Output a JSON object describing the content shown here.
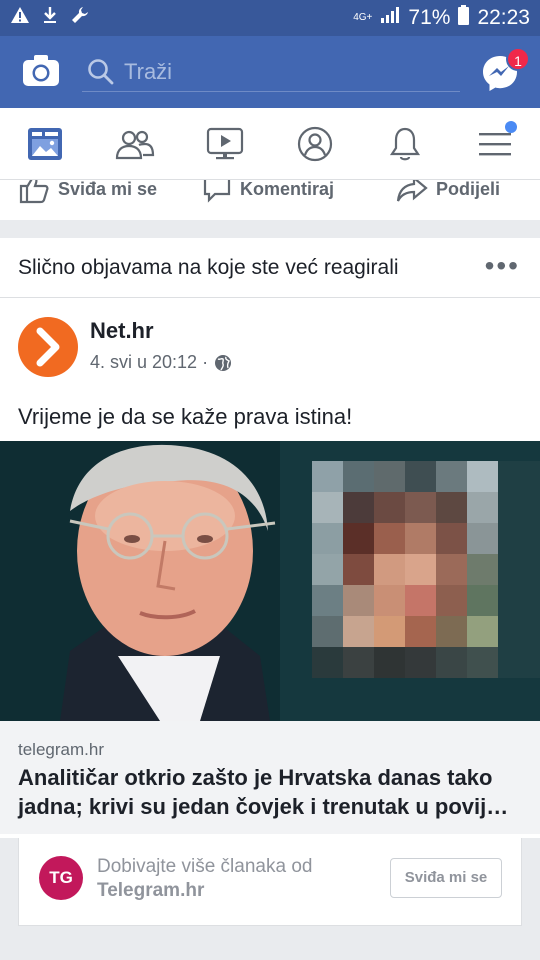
{
  "status_bar": {
    "network": "4G+",
    "battery_percent": "71%",
    "time": "22:23"
  },
  "header": {
    "search_placeholder": "Traži",
    "messenger_badge": "1"
  },
  "nav": {
    "items": [
      "news-feed",
      "friends",
      "watch",
      "profile",
      "notifications",
      "menu"
    ],
    "active": "news-feed"
  },
  "actions": {
    "like": "Sviđa mi se",
    "comment": "Komentiraj",
    "share": "Podijeli"
  },
  "card": {
    "header_title": "Slično objavama na koje ste već reagirali",
    "page_name": "Net.hr",
    "timestamp": "4. svi u 20:12 ·",
    "post_text": "Vrijeme je da se kaže prava istina!",
    "link_domain": "telegram.hr",
    "link_title": "Analitičar otkrio zašto je Hrvatska danas tako jadna; krivi su jedan čovjek i trenutak u povij…"
  },
  "suggest": {
    "logo_text": "TG",
    "line1": "Dobivajte više članaka od",
    "line2": "Telegram.hr",
    "button": "Sviđa mi se"
  },
  "colors": {
    "brand": "#4267b2",
    "status_bar": "#38589a",
    "netHr_orange": "#f16a21",
    "telegram_magenta": "#c2185b"
  }
}
